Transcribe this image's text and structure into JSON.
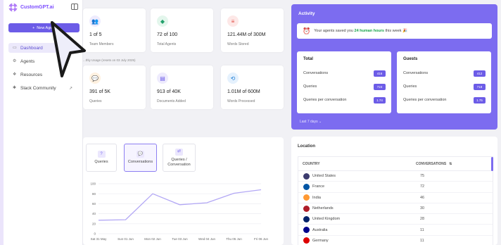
{
  "app": {
    "logo_text": "CustomGPT.ai"
  },
  "sidebar": {
    "new_agent_label": "New Agent",
    "items": [
      {
        "label": "Dashboard",
        "icon": "dashboard-icon",
        "active": true
      },
      {
        "label": "Agents",
        "icon": "agents-icon"
      },
      {
        "label": "Resources",
        "icon": "resources-icon"
      },
      {
        "label": "Slack Community",
        "icon": "slack-icon",
        "external": true
      }
    ]
  },
  "stats": [
    {
      "value": "1 of 5",
      "label": "Team Members",
      "icon": "team-icon",
      "color": "#6c5ce7"
    },
    {
      "value": "72 of 100",
      "label": "Total Agents",
      "icon": "agents-stack-icon",
      "color": "#22a06b"
    },
    {
      "value": "121.44M of 300M",
      "label": "Words Stored",
      "icon": "database-icon",
      "color": "#e0453c"
    },
    {
      "value": "391 of 5K",
      "label": "Queries",
      "icon": "chat-icon",
      "color": "#f08c00"
    },
    {
      "value": "913 of 40K",
      "label": "Documents Added",
      "icon": "document-icon",
      "color": "#6c5ce7"
    },
    {
      "value": "1.01M of 600M",
      "label": "Words Processed",
      "icon": "processing-icon",
      "color": "#1c7ed6"
    }
  ],
  "usage_note": "...thly Usage (resets on 03 July 2025)",
  "activity": {
    "title": "Activity",
    "savings_prefix": "Your agents saved you",
    "savings_highlight": "24 human hours",
    "savings_suffix": "this week 🎉",
    "total": {
      "title": "Total",
      "rows": [
        {
          "label": "Conversations",
          "value": "416"
        },
        {
          "label": "Queries",
          "value": "724"
        },
        {
          "label": "Queries per conversation",
          "value": "1.74"
        }
      ]
    },
    "guests": {
      "title": "Guests",
      "rows": [
        {
          "label": "Conversations",
          "value": "412"
        },
        {
          "label": "Queries",
          "value": "718"
        },
        {
          "label": "Queries per conversation",
          "value": "1.75"
        }
      ]
    },
    "range_label": "Last 7 days ⌄"
  },
  "chart_tabs": [
    {
      "label": "Queries",
      "active": false
    },
    {
      "label": "Conversations",
      "active": true
    },
    {
      "label": "Queries / Conversation",
      "active": false
    }
  ],
  "chart_data": {
    "type": "line",
    "categories": [
      "Sat 31 May",
      "Sun 01 Jun",
      "Mon 02 Jun",
      "Tue 03 Jun",
      "Wed 04 Jun",
      "Thu 05 Jun",
      "Fri 06 Jun"
    ],
    "series": [
      {
        "values": [
          27,
          28,
          80,
          58,
          62,
          81,
          88
        ]
      }
    ],
    "ylim": [
      0,
      100
    ],
    "yticks": [
      0,
      20,
      40,
      60,
      80,
      100
    ],
    "grid": true,
    "color": "#b3a8f5"
  },
  "location": {
    "title": "Location",
    "col_country": "COUNTRY",
    "col_conversations": "CONVERSATIONS",
    "rows": [
      {
        "country": "United States",
        "value": "75",
        "flag": "#3c3b6e"
      },
      {
        "country": "France",
        "value": "72",
        "flag": "#0055a4"
      },
      {
        "country": "India",
        "value": "46",
        "flag": "#ff9933"
      },
      {
        "country": "Netherlands",
        "value": "30",
        "flag": "#ae1c28"
      },
      {
        "country": "United Kingdom",
        "value": "28",
        "flag": "#012169"
      },
      {
        "country": "Australia",
        "value": "11",
        "flag": "#00008b"
      },
      {
        "country": "Germany",
        "value": "11",
        "flag": "#dd0000"
      }
    ]
  }
}
